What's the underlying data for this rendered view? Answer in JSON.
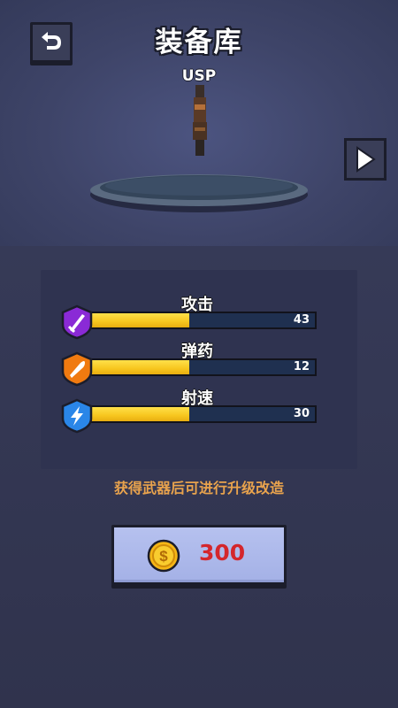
{
  "header": {
    "title": "装备库",
    "back_icon": "return-arrow-icon",
    "weapon_name": "USP",
    "next_icon": "play-right-icon"
  },
  "stats": [
    {
      "label": "攻击",
      "value": "43",
      "fill_ratio": 0.44,
      "icon": "sword-icon",
      "icon_color": "#8a2ad6"
    },
    {
      "label": "弹药",
      "value": "12",
      "fill_ratio": 0.44,
      "icon": "bullet-icon",
      "icon_color": "#f07a10"
    },
    {
      "label": "射速",
      "value": "30",
      "fill_ratio": 0.44,
      "icon": "lightning-icon",
      "icon_color": "#2a86e8"
    }
  ],
  "hint": "获得武器后可进行升级改造",
  "purchase": {
    "price": "300",
    "currency_icon": "dollar-coin-icon"
  },
  "colors": {
    "bar_fill": "#f7c61e",
    "price": "#d4262c",
    "hint": "#e9a34d"
  }
}
